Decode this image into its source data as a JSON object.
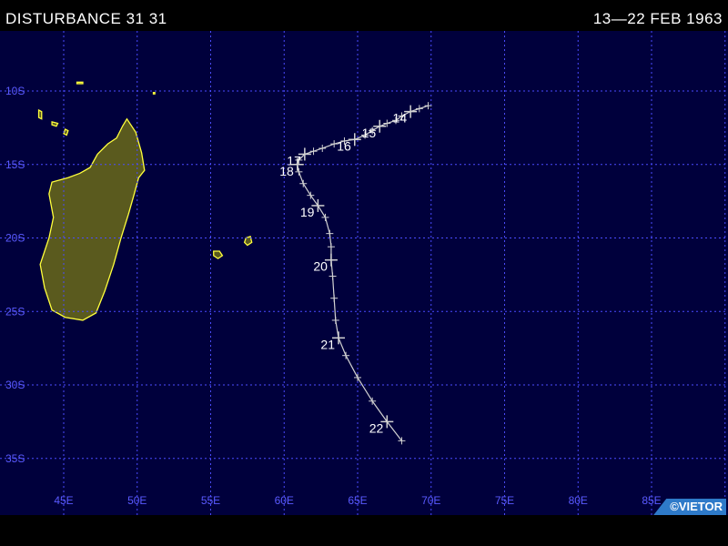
{
  "header": {
    "storm_name": "DISTURBANCE 31 31",
    "date_range": "13—22 FEB 1963"
  },
  "credit": "©VIETOR",
  "colors": {
    "ocean": "#00003c",
    "grid": "#4b4bff",
    "grid_labels": "#5a5aff",
    "land_fill": "#5a5a1e",
    "coast": "#ffff3c",
    "track": "#d2d2d2",
    "day_labels": "#ffffff",
    "credit_bg": "#2e7ac9"
  },
  "map": {
    "lon_range": [
      40,
      90
    ],
    "lat_range": [
      -38,
      -7
    ],
    "lon_labels": [
      {
        "lon": 45,
        "text": "45E"
      },
      {
        "lon": 50,
        "text": "50E"
      },
      {
        "lon": 55,
        "text": "55E"
      },
      {
        "lon": 60,
        "text": "60E"
      },
      {
        "lon": 65,
        "text": "65E"
      },
      {
        "lon": 70,
        "text": "70E"
      },
      {
        "lon": 75,
        "text": "75E"
      },
      {
        "lon": 80,
        "text": "80E"
      },
      {
        "lon": 85,
        "text": "85E"
      }
    ],
    "lat_labels": [
      {
        "lat": -10,
        "text": "10S"
      },
      {
        "lat": -15,
        "text": "15S"
      },
      {
        "lat": -20,
        "text": "20S"
      },
      {
        "lat": -25,
        "text": "25S"
      },
      {
        "lat": -30,
        "text": "30S"
      },
      {
        "lat": -35,
        "text": "35S"
      }
    ],
    "land": [
      {
        "name": "madagascar",
        "points": [
          [
            49.3,
            -11.9
          ],
          [
            49.9,
            -12.8
          ],
          [
            50.3,
            -14.2
          ],
          [
            50.5,
            -15.4
          ],
          [
            50.1,
            -15.9
          ],
          [
            49.8,
            -17.0
          ],
          [
            49.4,
            -18.4
          ],
          [
            48.9,
            -20.0
          ],
          [
            48.4,
            -21.8
          ],
          [
            47.8,
            -23.6
          ],
          [
            47.2,
            -25.1
          ],
          [
            46.3,
            -25.6
          ],
          [
            45.1,
            -25.4
          ],
          [
            44.2,
            -24.9
          ],
          [
            43.7,
            -23.4
          ],
          [
            43.4,
            -21.8
          ],
          [
            44.0,
            -20.0
          ],
          [
            44.3,
            -18.6
          ],
          [
            44.0,
            -17.0
          ],
          [
            44.2,
            -16.2
          ],
          [
            45.3,
            -15.9
          ],
          [
            46.1,
            -15.6
          ],
          [
            46.8,
            -15.2
          ],
          [
            47.3,
            -14.3
          ],
          [
            48.0,
            -13.6
          ],
          [
            48.6,
            -13.2
          ],
          [
            49.0,
            -12.4
          ]
        ]
      },
      {
        "name": "reunion",
        "points": [
          [
            55.2,
            -20.9
          ],
          [
            55.6,
            -20.9
          ],
          [
            55.8,
            -21.2
          ],
          [
            55.5,
            -21.4
          ],
          [
            55.2,
            -21.2
          ]
        ]
      },
      {
        "name": "mauritius",
        "points": [
          [
            57.4,
            -20.0
          ],
          [
            57.7,
            -19.9
          ],
          [
            57.8,
            -20.3
          ],
          [
            57.5,
            -20.5
          ],
          [
            57.3,
            -20.3
          ]
        ]
      },
      {
        "name": "comoros-1",
        "points": [
          [
            43.3,
            -11.3
          ],
          [
            43.5,
            -11.4
          ],
          [
            43.5,
            -11.9
          ],
          [
            43.3,
            -11.8
          ]
        ]
      },
      {
        "name": "comoros-2",
        "points": [
          [
            44.2,
            -12.1
          ],
          [
            44.6,
            -12.2
          ],
          [
            44.5,
            -12.4
          ],
          [
            44.2,
            -12.3
          ]
        ]
      },
      {
        "name": "comoros-3",
        "points": [
          [
            45.1,
            -12.6
          ],
          [
            45.3,
            -12.7
          ],
          [
            45.2,
            -13.0
          ],
          [
            45.0,
            -12.9
          ]
        ]
      },
      {
        "name": "islet-north",
        "points": [
          [
            45.9,
            -9.4
          ],
          [
            46.3,
            -9.4
          ],
          [
            46.3,
            -9.5
          ],
          [
            45.9,
            -9.5
          ]
        ]
      },
      {
        "name": "islet-north-2",
        "points": [
          [
            51.1,
            -10.1
          ],
          [
            51.2,
            -10.1
          ],
          [
            51.2,
            -10.2
          ],
          [
            51.1,
            -10.2
          ]
        ]
      },
      {
        "name": "islet-west",
        "points": [
          [
            40.0,
            -15.4
          ],
          [
            40.3,
            -15.4
          ],
          [
            40.3,
            -16.0
          ],
          [
            40.0,
            -16.0
          ]
        ]
      }
    ],
    "track": [
      {
        "lon": 69.8,
        "lat": -11.0
      },
      {
        "lon": 69.2,
        "lat": -11.2
      },
      {
        "lon": 68.6,
        "lat": -11.4
      },
      {
        "lon": 68.0,
        "lat": -11.7
      },
      {
        "lon": 67.6,
        "lat": -12.0
      },
      {
        "lon": 67.0,
        "lat": -12.2
      },
      {
        "lon": 66.5,
        "lat": -12.4
      },
      {
        "lon": 66.0,
        "lat": -12.7
      },
      {
        "lon": 65.5,
        "lat": -13.0
      },
      {
        "lon": 64.8,
        "lat": -13.3
      },
      {
        "lon": 64.1,
        "lat": -13.4
      },
      {
        "lon": 63.4,
        "lat": -13.6
      },
      {
        "lon": 62.6,
        "lat": -13.9
      },
      {
        "lon": 62.0,
        "lat": -14.1
      },
      {
        "lon": 61.4,
        "lat": -14.3
      },
      {
        "lon": 61.0,
        "lat": -14.7
      },
      {
        "lon": 60.9,
        "lat": -15.0
      },
      {
        "lon": 61.0,
        "lat": -15.5
      },
      {
        "lon": 61.3,
        "lat": -16.3
      },
      {
        "lon": 61.8,
        "lat": -17.1
      },
      {
        "lon": 62.3,
        "lat": -17.8
      },
      {
        "lon": 62.8,
        "lat": -18.6
      },
      {
        "lon": 63.1,
        "lat": -19.7
      },
      {
        "lon": 63.2,
        "lat": -20.6
      },
      {
        "lon": 63.2,
        "lat": -21.5
      },
      {
        "lon": 63.3,
        "lat": -22.6
      },
      {
        "lon": 63.4,
        "lat": -24.1
      },
      {
        "lon": 63.5,
        "lat": -25.6
      },
      {
        "lon": 63.7,
        "lat": -26.8
      },
      {
        "lon": 64.2,
        "lat": -28.0
      },
      {
        "lon": 65.0,
        "lat": -29.5
      },
      {
        "lon": 66.0,
        "lat": -31.1
      },
      {
        "lon": 67.0,
        "lat": -32.5
      },
      {
        "lon": 68.0,
        "lat": -33.8
      }
    ],
    "day_markers": [
      {
        "label": "14",
        "lon": 68.6,
        "lat": -11.4
      },
      {
        "label": "15",
        "lon": 66.5,
        "lat": -12.4
      },
      {
        "label": "16",
        "lon": 64.8,
        "lat": -13.3
      },
      {
        "label": "17",
        "lon": 61.4,
        "lat": -14.3
      },
      {
        "label": "18",
        "lon": 60.9,
        "lat": -15.0
      },
      {
        "label": "19",
        "lon": 62.3,
        "lat": -17.8
      },
      {
        "label": "20",
        "lon": 63.2,
        "lat": -21.5
      },
      {
        "label": "21",
        "lon": 63.7,
        "lat": -26.8
      },
      {
        "label": "22",
        "lon": 67.0,
        "lat": -32.5
      }
    ]
  }
}
